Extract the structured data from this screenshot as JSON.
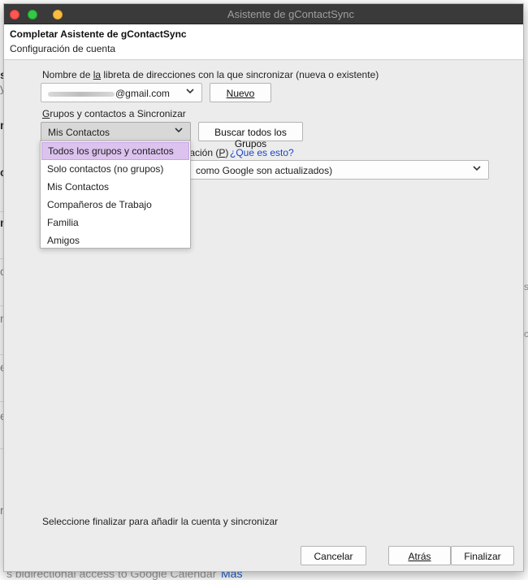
{
  "window": {
    "title": "Asistente de gContactSync"
  },
  "header": {
    "title": "Completar Asistente de gContactSync",
    "subtitle": "Configuración de cuenta"
  },
  "addressbook": {
    "label_pre": "Nombre de ",
    "label_access": "la",
    "label_post": " libreta de direcciones con la que sincronizar (nueva o existente)",
    "value_suffix": "@gmail.com",
    "new_button": "Nuevo"
  },
  "groups": {
    "label_access": "G",
    "label_rest": "rupos y contactos a Sincronizar",
    "selected": "Mis Contactos",
    "fetch_button": "Buscar todos los Grupos",
    "options": [
      "Todos los grupos y contactos",
      "Solo contactos (no grupos)",
      "Mis Contactos",
      "Compañeros de Trabajo",
      "Familia",
      "Amigos"
    ]
  },
  "sync_direction": {
    "label_partial": "nización (",
    "label_access": "P",
    "label_end": ")",
    "help_link": "¿Que es esto?",
    "value_partial": "como Google son actualizados)"
  },
  "footer": {
    "instruction": "Seleccione finalizar para añadir la cuenta y sincronizar",
    "cancel": "Cancelar",
    "back": "Atrás",
    "finish": "Finalizar"
  },
  "background": {
    "bottom_text": "s bidirectional access to Google Calendar",
    "bottom_link": "Más"
  }
}
